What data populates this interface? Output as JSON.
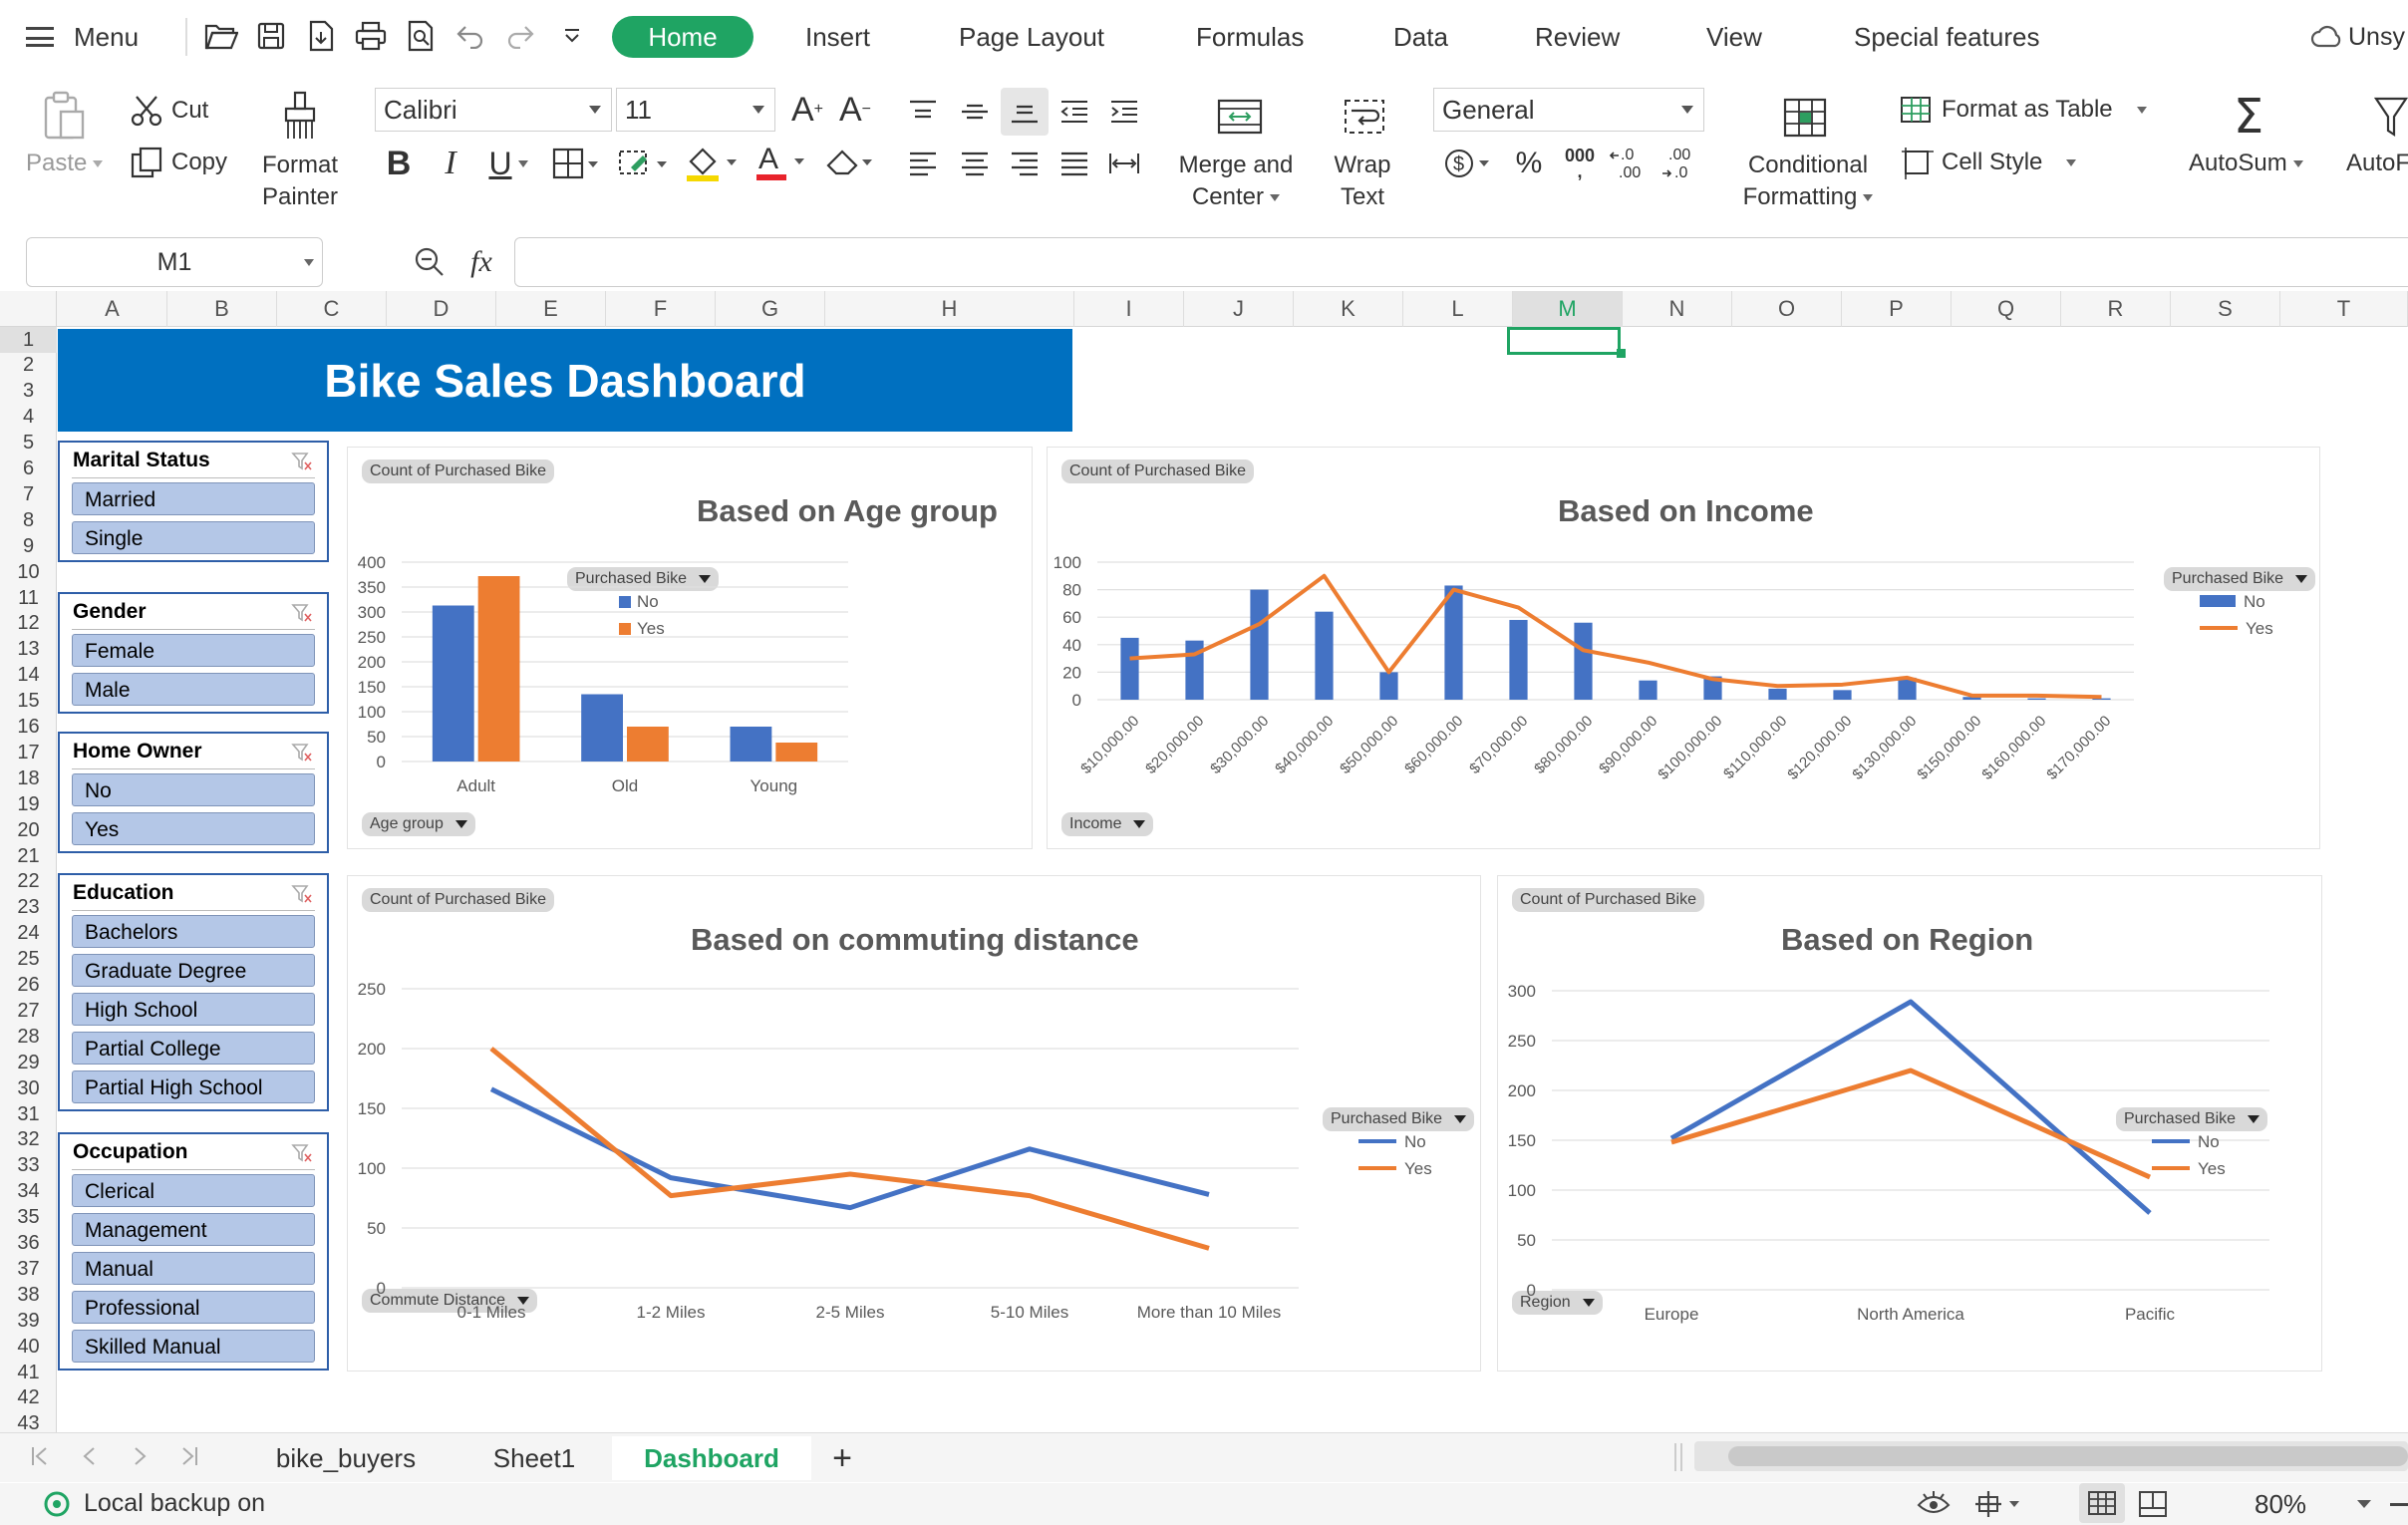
{
  "toolbar": {
    "menu": "Menu",
    "tabs": [
      "Home",
      "Insert",
      "Page Layout",
      "Formulas",
      "Data",
      "Review",
      "View",
      "Special features"
    ],
    "unsync": "Unsy"
  },
  "ribbon": {
    "paste": "Paste",
    "cut": "Cut",
    "copy": "Copy",
    "format_painter_1": "Format",
    "format_painter_2": "Painter",
    "font": "Calibri",
    "size": "11",
    "merge_1": "Merge and",
    "merge_2": "Center",
    "wrap_1": "Wrap",
    "wrap_2": "Text",
    "number_format": "General",
    "percent": "%",
    "thousands": "000",
    "cond_1": "Conditional",
    "cond_2": "Formatting",
    "format_table": "Format as Table",
    "cell_style": "Cell Style",
    "autosum": "AutoSum",
    "autofilter": "AutoF"
  },
  "formula": {
    "name_box": "M1",
    "fx": "fx",
    "value": ""
  },
  "columns": [
    "A",
    "B",
    "C",
    "D",
    "E",
    "F",
    "G",
    "H",
    "I",
    "J",
    "K",
    "L",
    "M",
    "N",
    "O",
    "P",
    "Q",
    "R",
    "S",
    "T"
  ],
  "rows": [
    "1",
    "2",
    "3",
    "4",
    "5",
    "6",
    "7",
    "8",
    "9",
    "10",
    "11",
    "12",
    "13",
    "14",
    "15",
    "16",
    "17",
    "18",
    "19",
    "20",
    "21",
    "22",
    "23",
    "24",
    "25",
    "26",
    "27",
    "28",
    "29",
    "30",
    "31",
    "32",
    "33",
    "34",
    "35",
    "36",
    "37",
    "38",
    "39",
    "40",
    "41",
    "42",
    "43"
  ],
  "dashboard": {
    "title": "Bike Sales Dashboard"
  },
  "slicers": [
    {
      "title": "Marital Status",
      "items": [
        "Married",
        "Single"
      ]
    },
    {
      "title": "Gender",
      "items": [
        "Female",
        "Male"
      ]
    },
    {
      "title": "Home Owner",
      "items": [
        "No",
        "Yes"
      ]
    },
    {
      "title": "Education",
      "items": [
        "Bachelors",
        "Graduate Degree",
        "High School",
        "Partial College",
        "Partial High School"
      ]
    },
    {
      "title": "Occupation",
      "items": [
        "Clerical",
        "Management",
        "Manual",
        "Professional",
        "Skilled Manual"
      ]
    }
  ],
  "chart_data": [
    {
      "type": "bar",
      "title": "Based on Age group",
      "value_field": "Count of Purchased Bike",
      "axis_field": "Age group",
      "legend_field": "Purchased Bike",
      "categories": [
        "Adult",
        "Old",
        "Young"
      ],
      "series": [
        {
          "name": "No",
          "color": "#4472c4",
          "values": [
            313,
            135,
            70
          ]
        },
        {
          "name": "Yes",
          "color": "#ed7d31",
          "values": [
            372,
            70,
            38
          ]
        }
      ],
      "ylim": [
        0,
        400
      ],
      "yticks": [
        "400",
        "350",
        "300",
        "250",
        "200",
        "150",
        "100",
        "50",
        "0"
      ],
      "legend_position": "right",
      "grid": true
    },
    {
      "type": "bar+line",
      "title": "Based on Income",
      "value_field": "Count of Purchased Bike",
      "axis_field": "Income",
      "legend_field": "Purchased Bike",
      "categories": [
        "$10,000.00",
        "$20,000.00",
        "$30,000.00",
        "$40,000.00",
        "$50,000.00",
        "$60,000.00",
        "$70,000.00",
        "$80,000.00",
        "$90,000.00",
        "$100,000.00",
        "$110,000.00",
        "$120,000.00",
        "$130,000.00",
        "$150,000.00",
        "$160,000.00",
        "$170,000.00"
      ],
      "series": [
        {
          "name": "No",
          "color": "#4472c4",
          "values": [
            45,
            43,
            80,
            64,
            20,
            83,
            58,
            56,
            14,
            17,
            8,
            7,
            16,
            2,
            1,
            1
          ]
        },
        {
          "name": "Yes",
          "color": "#ed7d31",
          "values": [
            30,
            33,
            55,
            90,
            20,
            80,
            67,
            36,
            27,
            15,
            10,
            11,
            16,
            3,
            3,
            2
          ]
        }
      ],
      "ylim": [
        0,
        100
      ],
      "yticks": [
        "100",
        "80",
        "60",
        "40",
        "20",
        "0"
      ],
      "legend_position": "right",
      "grid": true
    },
    {
      "type": "line",
      "title": "Based on commuting distance",
      "value_field": "Count of Purchased Bike",
      "axis_field": "Commute Distance",
      "legend_field": "Purchased Bike",
      "categories": [
        "0-1 Miles",
        "1-2 Miles",
        "2-5 Miles",
        "5-10 Miles",
        "More than 10 Miles"
      ],
      "series": [
        {
          "name": "No",
          "color": "#4472c4",
          "values": [
            166,
            92,
            67,
            116,
            78
          ]
        },
        {
          "name": "Yes",
          "color": "#ed7d31",
          "values": [
            200,
            77,
            95,
            77,
            33
          ]
        }
      ],
      "ylim": [
        0,
        250
      ],
      "yticks": [
        "250",
        "200",
        "150",
        "100",
        "50",
        "0"
      ],
      "legend_position": "right",
      "grid": true
    },
    {
      "type": "line",
      "title": "Based on Region",
      "value_field": "Count of Purchased Bike",
      "axis_field": "Region",
      "legend_field": "Purchased Bike",
      "categories": [
        "Europe",
        "North America",
        "Pacific"
      ],
      "series": [
        {
          "name": "No",
          "color": "#4472c4",
          "values": [
            152,
            289,
            77
          ]
        },
        {
          "name": "Yes",
          "color": "#ed7d31",
          "values": [
            148,
            220,
            113
          ]
        }
      ],
      "ylim": [
        0,
        300
      ],
      "yticks": [
        "300",
        "250",
        "200",
        "150",
        "100",
        "50",
        "0"
      ],
      "legend_position": "right",
      "grid": true
    }
  ],
  "sheets": {
    "tabs": [
      "bike_buyers",
      "Sheet1",
      "Dashboard"
    ],
    "active": "Dashboard",
    "add": "+"
  },
  "status": {
    "backup": "Local backup on",
    "zoom": "80%"
  }
}
